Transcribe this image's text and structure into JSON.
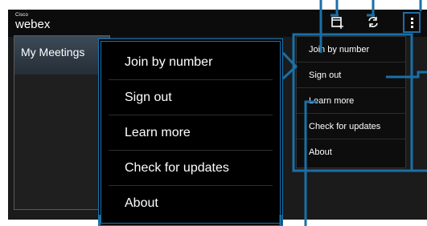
{
  "app": {
    "logo_small": "Cisco",
    "logo_main": "webex"
  },
  "actionbar": {
    "icons": [
      "calendar-add-icon",
      "sync-icon",
      "overflow-menu-icon"
    ]
  },
  "sidebar": {
    "tab_label": "My Meetings"
  },
  "menu": {
    "items": [
      "Join by number",
      "Sign out",
      "Learn more",
      "Check for updates",
      "About"
    ]
  },
  "colors": {
    "callout": "#1b6fa6",
    "actionbar_bg": "#0c0c0c",
    "menu_bg": "#000000",
    "text": "#ffffff"
  }
}
